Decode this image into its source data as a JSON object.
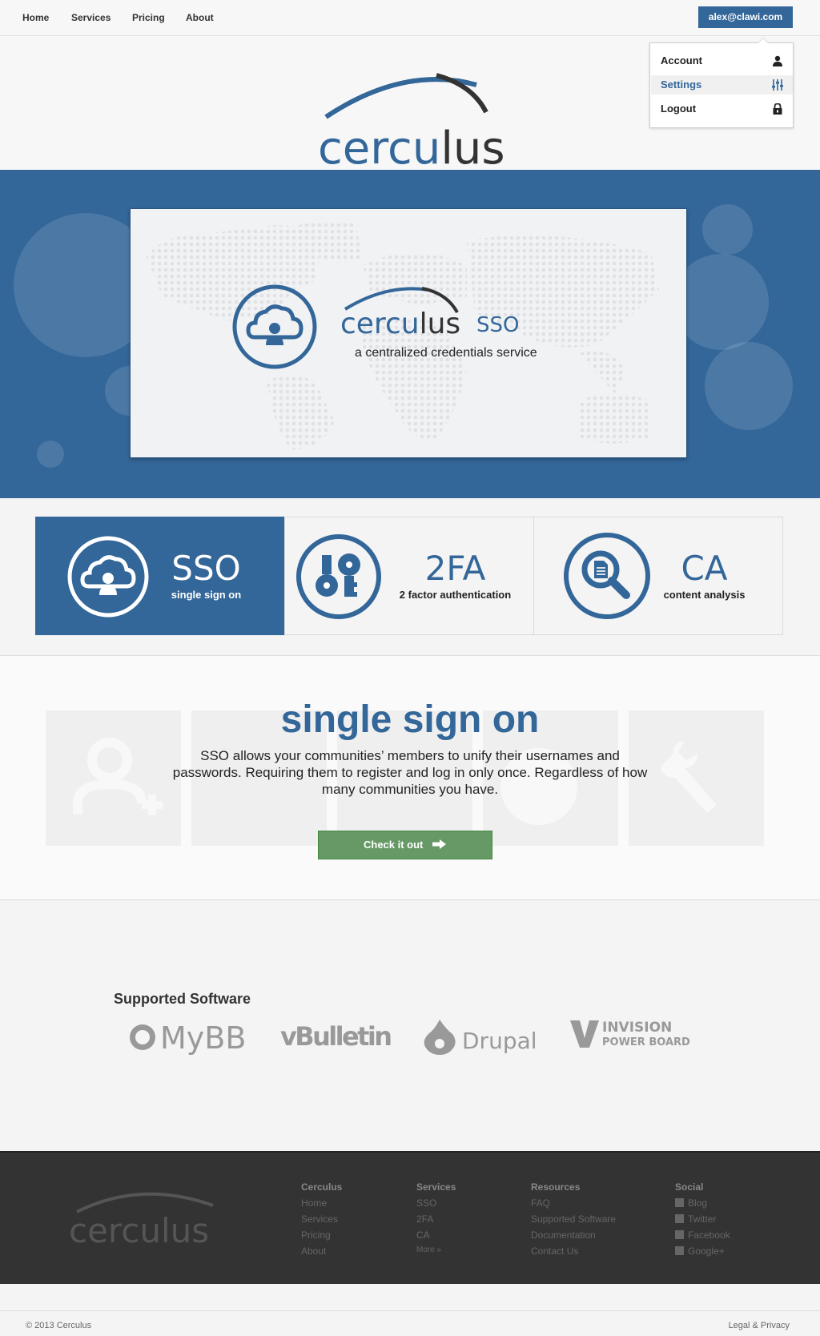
{
  "nav": {
    "links": [
      "Home",
      "Services",
      "Pricing",
      "About"
    ],
    "user_email": "alex@clawi.com"
  },
  "dropdown": {
    "items": [
      {
        "label": "Account",
        "icon": "user-icon"
      },
      {
        "label": "Settings",
        "icon": "sliders-icon"
      },
      {
        "label": "Logout",
        "icon": "lock-icon"
      }
    ],
    "active_index": 1
  },
  "brand": {
    "logo_text": "cerculus",
    "logo_text_light": "cercu",
    "logo_text_dark": "lus",
    "product_suffix": "SSO",
    "tagline": "a centralized credentials service"
  },
  "features": [
    {
      "title": "SSO",
      "subtitle": "single sign on",
      "icon": "cloud-user-icon",
      "active": true
    },
    {
      "title": "2FA",
      "subtitle": "2 factor authentication",
      "icon": "keys-icon",
      "active": false
    },
    {
      "title": "CA",
      "subtitle": "content analysis",
      "icon": "magnify-document-icon",
      "active": false
    }
  ],
  "sso_section": {
    "title": "single sign on",
    "description": "SSO allows your communities’ members to unify their usernames and passwords. Requiring them to register and log in only once. Regardless of how many communities you have.",
    "button_label": "Check it out"
  },
  "software": {
    "title": "Supported Software",
    "logos": [
      "MyBB",
      "vBulletin",
      "Drupal",
      "INVISION",
      "POWER BOARD"
    ]
  },
  "footer": {
    "logo_text": "cerculus",
    "columns": [
      {
        "heading": "Cerculus",
        "links": [
          "Home",
          "Services",
          "Pricing",
          "About"
        ]
      },
      {
        "heading": "Services",
        "links": [
          "SSO",
          "2FA",
          "CA",
          "More »"
        ]
      },
      {
        "heading": "Resources",
        "links": [
          "FAQ",
          "Supported Software",
          "Documentation",
          "Contact Us"
        ]
      },
      {
        "heading": "Social",
        "links": [
          "Blog",
          "Twitter",
          "Facebook",
          "Google+"
        ]
      }
    ]
  },
  "bottom": {
    "copyright": "© 2013 Cerculus",
    "legal": "Legal & Privacy"
  },
  "colors": {
    "brand_blue": "#336699",
    "button_green": "#669966",
    "footer_bg": "#333333"
  }
}
